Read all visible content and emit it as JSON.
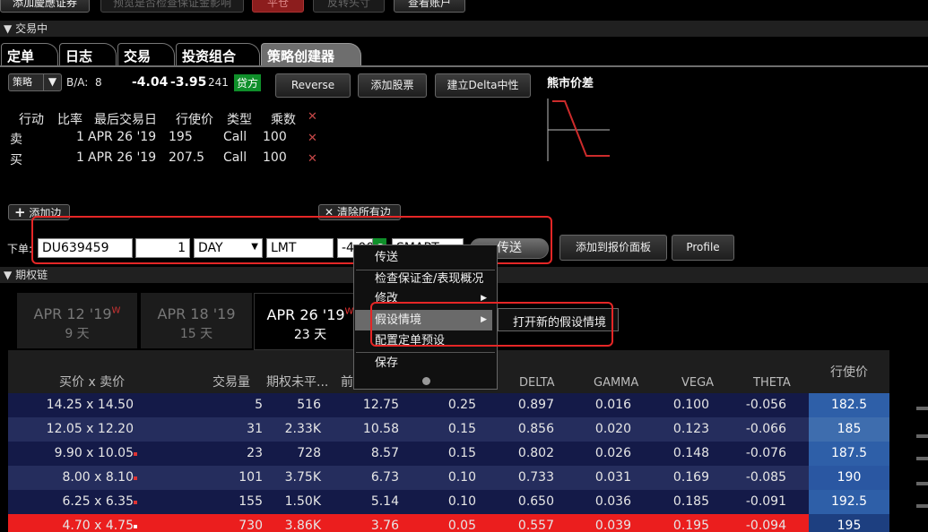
{
  "toolbar": {
    "btn1": "添加慶應证券",
    "btn2": "预览是否检查保证金影响",
    "btn3": "平仓",
    "btn4": "反转头寸",
    "btn5": "查看账户"
  },
  "section_trading": "交易中",
  "tabs": [
    "定单",
    "日志",
    "交易",
    "投资组合",
    "策略创建器"
  ],
  "strategy": {
    "type_label": "策略",
    "ba_label": "B/A:",
    "size_bid": "8",
    "bid": "-4.04",
    "ask": "-3.95",
    "size_ask": "241",
    "side_badge": "贷方",
    "reverse_btn": "Reverse",
    "add_stock_btn": "添加股票",
    "delta_neutral_btn": "建立Delta中性",
    "chart_title": "熊市价差"
  },
  "legs": {
    "headers": [
      "行动",
      "比率",
      "最后交易日",
      "行使价",
      "类型",
      "乘数"
    ],
    "rows": [
      {
        "action": "卖",
        "ratio": "1",
        "last_trade": "APR 26 '19",
        "strike": "195",
        "type": "Call",
        "multiplier": "100"
      },
      {
        "action": "买",
        "ratio": "1",
        "last_trade": "APR 26 '19",
        "strike": "207.5",
        "type": "Call",
        "multiplier": "100"
      }
    ],
    "add_leg": "添加边",
    "clear_all": "清除所有边"
  },
  "order": {
    "label": "下单:",
    "account": "DU639459",
    "quantity": "1",
    "tif": "DAY",
    "order_type": "LMT",
    "price": "-4.00",
    "destination": "SMART",
    "send": "传送",
    "add_to_quote": "添加到报价面板",
    "profile": "Profile"
  },
  "context_menu": {
    "items": [
      "传送",
      "检查保证金/表现概况",
      "修改",
      "假设情境",
      "配置定单预设",
      "保存"
    ],
    "submenu_item": "打开新的假设情境"
  },
  "section_chain": "期权链",
  "expirations": [
    {
      "date": "APR 12 '19",
      "flag": "W",
      "days": "9 天"
    },
    {
      "date": "APR 18 '19",
      "flag": "",
      "days": "15 天"
    },
    {
      "date": "APR 26 '19",
      "flag": "W",
      "days": "23 天"
    }
  ],
  "chain": {
    "headers": {
      "bid_ask": "买价 x 卖价",
      "volume": "交易量",
      "open_interest": "期权未平...",
      "prev": "前",
      "delta": "DELTA",
      "gamma": "GAMMA",
      "vega": "VEGA",
      "theta": "THETA",
      "strike": "行使价"
    },
    "rows": [
      {
        "bid_ask": "14.25 x 14.50",
        "volume": "5",
        "oi": "516",
        "prev": "12.75",
        "col5": "0.25",
        "delta": "0.897",
        "gamma": "0.016",
        "vega": "0.100",
        "theta": "-0.056",
        "strike": "182.5"
      },
      {
        "bid_ask": "12.05 x 12.20",
        "volume": "31",
        "oi": "2.33K",
        "prev": "10.58",
        "col5": "0.15",
        "delta": "0.856",
        "gamma": "0.020",
        "vega": "0.123",
        "theta": "-0.066",
        "strike": "185"
      },
      {
        "bid_ask": "9.90 x 10.05",
        "volume": "23",
        "oi": "728",
        "prev": "8.57",
        "col5": "0.15",
        "delta": "0.802",
        "gamma": "0.026",
        "vega": "0.148",
        "theta": "-0.076",
        "strike": "187.5"
      },
      {
        "bid_ask": "8.00 x 8.10",
        "volume": "101",
        "oi": "3.75K",
        "prev": "6.73",
        "col5": "0.10",
        "delta": "0.733",
        "gamma": "0.031",
        "vega": "0.169",
        "theta": "-0.085",
        "strike": "190"
      },
      {
        "bid_ask": "6.25 x 6.35",
        "volume": "155",
        "oi": "1.50K",
        "prev": "5.14",
        "col5": "0.10",
        "delta": "0.650",
        "gamma": "0.036",
        "vega": "0.185",
        "theta": "-0.091",
        "strike": "192.5"
      },
      {
        "bid_ask": "4.70 x 4.75",
        "volume": "730",
        "oi": "3.86K",
        "prev": "3.76",
        "col5": "0.05",
        "delta": "0.557",
        "gamma": "0.039",
        "vega": "0.195",
        "theta": "-0.094",
        "strike": "195"
      }
    ]
  },
  "colors": {
    "highlight_red": "#e52626",
    "badge_green": "#0f8f2a",
    "strike_blue": "#2d5ea6",
    "row_navy": "#151a4a"
  }
}
